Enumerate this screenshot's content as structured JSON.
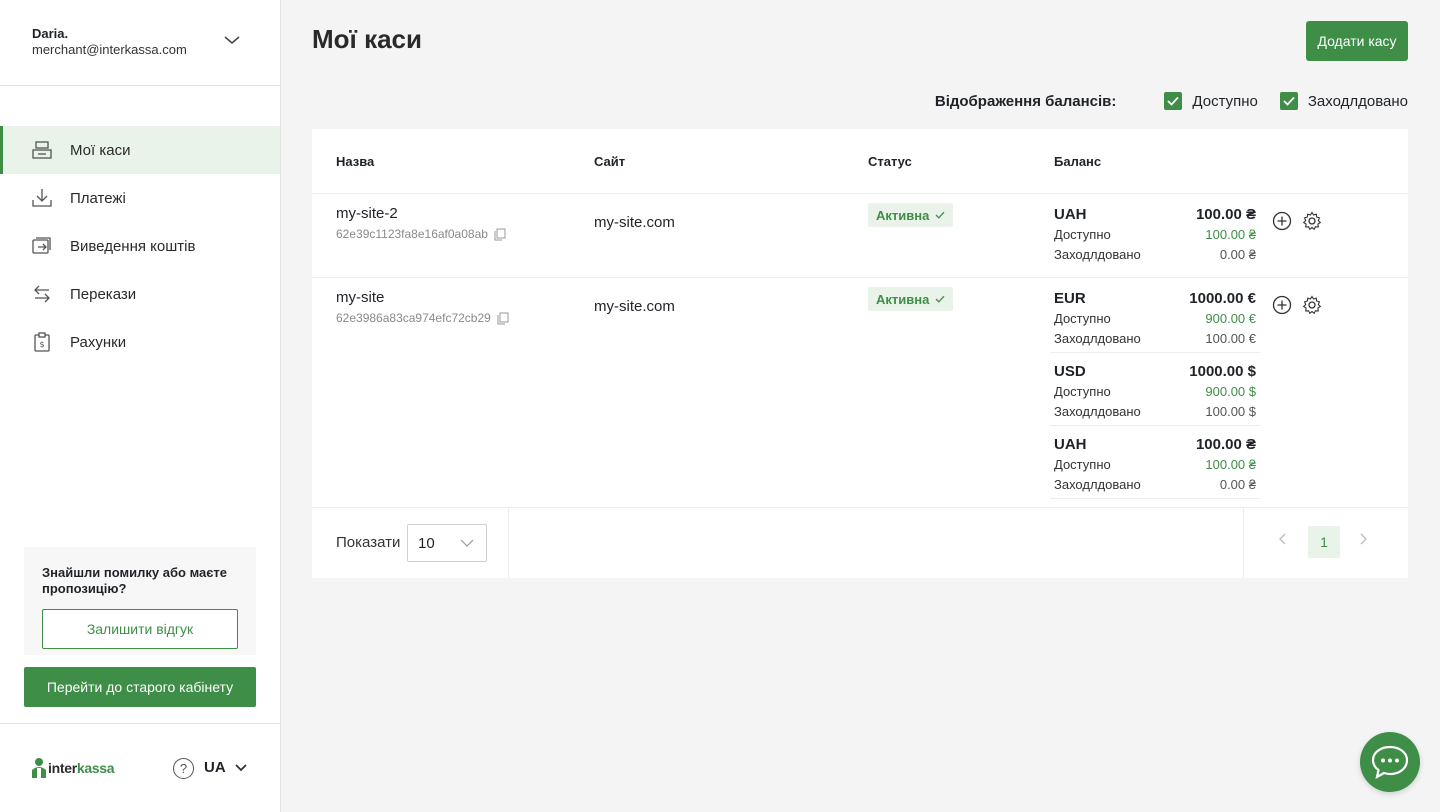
{
  "user": {
    "name": "Daria.",
    "email": "merchant@interkassa.com"
  },
  "nav": [
    {
      "label": "Мої каси",
      "icon": "cashbox-icon",
      "active": true
    },
    {
      "label": "Платежі",
      "icon": "download-tray-icon",
      "active": false
    },
    {
      "label": "Виведення коштів",
      "icon": "withdraw-icon",
      "active": false
    },
    {
      "label": "Перекази",
      "icon": "transfer-arrows-icon",
      "active": false
    },
    {
      "label": "Рахунки",
      "icon": "invoice-icon",
      "active": false
    }
  ],
  "feedback": {
    "text": "Знайшли помилку або маєте пропозицію?",
    "button": "Залишити відгук"
  },
  "old_cabinet_button": "Перейти до старого кабінету",
  "footer": {
    "logo": {
      "part1": "inter",
      "part2": "kassa"
    },
    "help": "?",
    "language": "UA"
  },
  "page": {
    "title": "Мої каси",
    "add_button": "Додати касу"
  },
  "balance_display": {
    "label": "Відображення балансів:",
    "available": "Доступно",
    "hold": "Заходлдовано"
  },
  "table": {
    "headers": {
      "name": "Назва",
      "site": "Сайт",
      "status": "Статус",
      "balance": "Баланс"
    },
    "rows": [
      {
        "name": "my-site-2",
        "id": "62e39c1123fa8e16af0a08ab",
        "site": "my-site.com",
        "status": "Активна",
        "balances": [
          {
            "currency": "UAH",
            "total": "100.00 ₴",
            "available_label": "Доступно",
            "available": "100.00 ₴",
            "hold_label": "Заходлдовано",
            "hold": "0.00 ₴"
          }
        ]
      },
      {
        "name": "my-site",
        "id": "62e3986a83ca974efc72cb29",
        "site": "my-site.com",
        "status": "Активна",
        "balances": [
          {
            "currency": "EUR",
            "total": "1000.00 €",
            "available_label": "Доступно",
            "available": "900.00 €",
            "hold_label": "Заходлдовано",
            "hold": "100.00 €"
          },
          {
            "currency": "USD",
            "total": "1000.00 $",
            "available_label": "Доступно",
            "available": "900.00 $",
            "hold_label": "Заходлдовано",
            "hold": "100.00 $"
          },
          {
            "currency": "UAH",
            "total": "100.00 ₴",
            "available_label": "Доступно",
            "available": "100.00 ₴",
            "hold_label": "Заходлдовано",
            "hold": "0.00 ₴"
          }
        ]
      }
    ]
  },
  "pagination": {
    "show_label": "Показати",
    "page_size": "10",
    "current_page": "1"
  },
  "colors": {
    "accent": "#3e8e47",
    "accent_light": "#e9f3ea"
  }
}
